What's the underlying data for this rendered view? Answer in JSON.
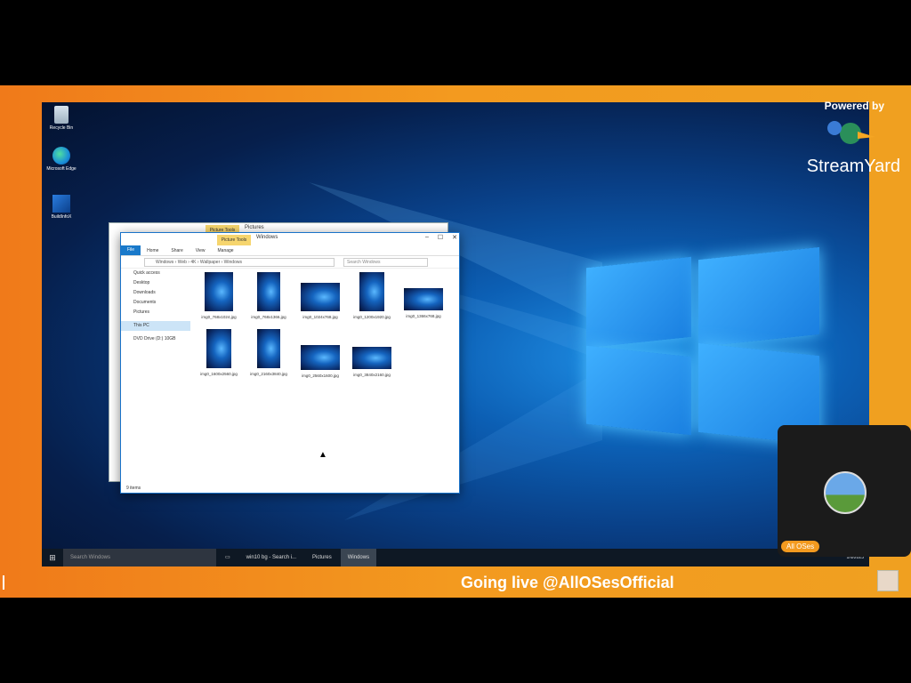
{
  "desktop_icons": [
    {
      "label": "Recycle Bin",
      "icon": "recycle-bin-icon"
    },
    {
      "label": "Microsoft Edge",
      "icon": "edge-icon"
    },
    {
      "label": "BuildInfoX",
      "icon": "app-icon"
    }
  ],
  "explorer_back": {
    "ctx_tab": "Picture Tools",
    "title": "Pictures"
  },
  "explorer": {
    "ctx_tab": "Picture Tools",
    "title": "Windows",
    "ribbon_tabs": [
      "File",
      "Home",
      "Share",
      "View",
      "Manage"
    ],
    "address_path": "Windows › Web › 4K › Wallpaper › Windows",
    "search_placeholder": "Search Windows",
    "nav_items": [
      "Quick access",
      "Desktop",
      "Downloads",
      "Documents",
      "Pictures",
      "This PC",
      "DVD Drive (D:) 10GB"
    ],
    "files": [
      "img0_768x1024.jpg",
      "img0_768x1366.jpg",
      "img0_1024x768.jpg",
      "img0_1200x1920.jpg",
      "img0_1366x768.jpg",
      "img0_1600x2560.jpg",
      "img0_2160x3840.jpg",
      "img0_2560x1600.jpg",
      "img0_3840x2160.jpg"
    ],
    "status": "9 items"
  },
  "taskbar": {
    "search_placeholder": "Search Windows",
    "items": [
      "win10 bg - Search i...",
      "Pictures",
      "Windows"
    ],
    "tray_time": "1/6/2023"
  },
  "overlay": {
    "powered_by": "Powered by",
    "brand": "StreamYard",
    "cam_name": "All OSes",
    "banner": "Going live @AllOSesOfficial"
  }
}
